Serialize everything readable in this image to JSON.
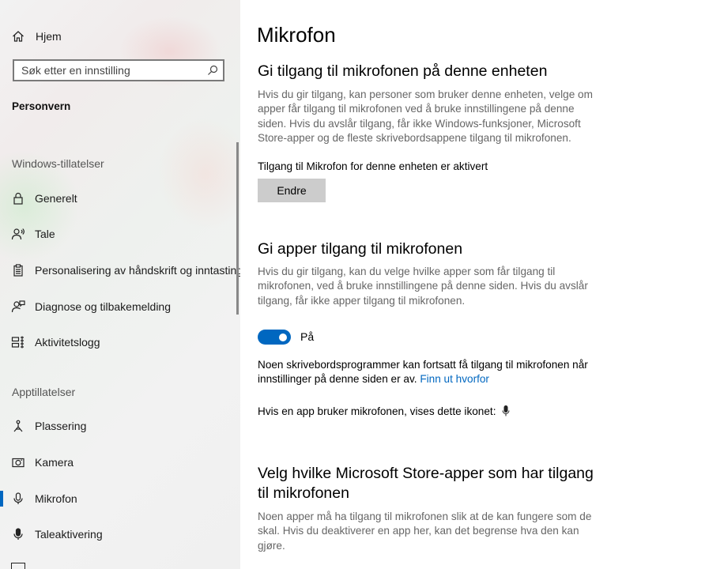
{
  "sidebar": {
    "home_label": "Hjem",
    "search_placeholder": "Søk etter en innstilling",
    "category": "Personvern",
    "sections": {
      "windows": "Windows-tillatelser",
      "apps": "Apptillatelser"
    },
    "windows_items": [
      {
        "label": "Generelt",
        "icon": "lock-icon"
      },
      {
        "label": "Tale",
        "icon": "speech-icon"
      },
      {
        "label": "Personalisering av håndskrift og inntasting",
        "icon": "clipboard-icon"
      },
      {
        "label": "Diagnose og tilbakemelding",
        "icon": "feedback-icon"
      },
      {
        "label": "Aktivitetslogg",
        "icon": "timeline-icon"
      }
    ],
    "app_items": [
      {
        "label": "Plassering",
        "icon": "location-icon"
      },
      {
        "label": "Kamera",
        "icon": "camera-icon"
      },
      {
        "label": "Mikrofon",
        "icon": "microphone-icon",
        "selected": true
      },
      {
        "label": "Taleaktivering",
        "icon": "voice-activation-icon"
      }
    ],
    "accent_color": "#0067c0"
  },
  "main": {
    "title": "Mikrofon",
    "device_access": {
      "heading": "Gi tilgang til mikrofonen på denne enheten",
      "description_lines": [
        "Hvis du gir tilgang, kan personer som bruker denne enheten, velge om",
        "apper får tilgang til mikrofonen ved å bruke innstillingene på denne",
        "siden. Hvis du avslår tilgang, får ikke Windows-funksjoner, Microsoft",
        "Store-apper og de fleste skrivebordsappene tilgang til mikrofonen."
      ],
      "status": "Tilgang til Mikrofon for denne enheten er aktivert",
      "change_button": "Endre"
    },
    "app_access": {
      "heading": "Gi apper tilgang til mikrofonen",
      "description_lines": [
        "Hvis du gir tilgang, kan du velge hvilke apper som får tilgang til",
        "mikrofonen, ved å bruke innstillingene på denne siden. Hvis du avslår",
        "tilgang, får ikke apper tilgang til mikrofonen."
      ],
      "toggle_label": "På",
      "toggle_on": true,
      "note_line1": "Noen skrivebordsprogrammer kan fortsatt få tilgang til mikrofonen når",
      "note_line2": "innstillinger på denne siden er av.",
      "note_link": "Finn ut hvorfor",
      "icon_note": "Hvis en app bruker mikrofonen, vises dette ikonet:"
    },
    "store_apps": {
      "heading_line1": "Velg hvilke Microsoft Store-apper som har tilgang",
      "heading_line2": "til mikrofonen",
      "description_lines": [
        "Noen apper må ha tilgang til mikrofonen slik at de kan fungere som de",
        "skal. Hvis du deaktiverer en app her, kan det begrense hva den kan",
        "gjøre."
      ]
    }
  }
}
